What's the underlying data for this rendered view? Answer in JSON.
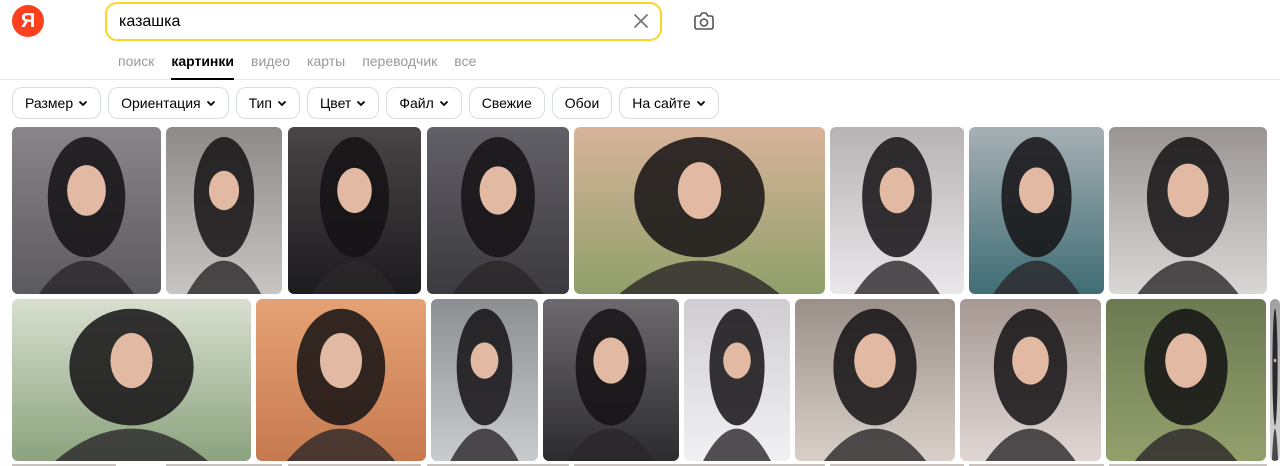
{
  "header": {
    "logo_text": "Я",
    "search": {
      "value": "казашка",
      "clear_icon": "close-icon",
      "camera_icon": "camera-icon"
    },
    "tabs": [
      {
        "label": "поиск",
        "active": false
      },
      {
        "label": "картинки",
        "active": true
      },
      {
        "label": "видео",
        "active": false
      },
      {
        "label": "карты",
        "active": false
      },
      {
        "label": "переводчик",
        "active": false
      },
      {
        "label": "все",
        "active": false
      }
    ]
  },
  "filters": [
    {
      "label": "Размер",
      "dropdown": true
    },
    {
      "label": "Ориентация",
      "dropdown": true
    },
    {
      "label": "Тип",
      "dropdown": true
    },
    {
      "label": "Цвет",
      "dropdown": true
    },
    {
      "label": "Файл",
      "dropdown": true
    },
    {
      "label": "Свежие",
      "dropdown": false
    },
    {
      "label": "Обои",
      "dropdown": false
    },
    {
      "label": "На сайте",
      "dropdown": true
    }
  ],
  "colors": {
    "brand": "#fc3f1d",
    "search_border": "#fed42b",
    "tab_inactive": "#999999",
    "chip_border": "#d9dce2"
  }
}
